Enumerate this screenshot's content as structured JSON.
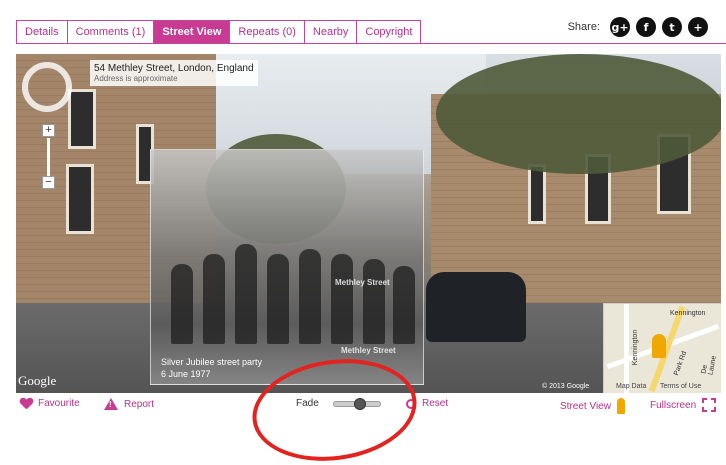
{
  "tabs": [
    {
      "label": "Details",
      "active": false
    },
    {
      "label": "Comments (1)",
      "active": false
    },
    {
      "label": "Street View",
      "active": true
    },
    {
      "label": "Repeats (0)",
      "active": false
    },
    {
      "label": "Nearby",
      "active": false
    },
    {
      "label": "Copyright",
      "active": false
    }
  ],
  "share": {
    "label": "Share:",
    "icons": [
      "google-plus-icon",
      "facebook-icon",
      "twitter-icon",
      "add-icon"
    ]
  },
  "streetview": {
    "address": "54 Methley Street, London, England",
    "address_note": "Address is approximate",
    "road_label": "Methley Street",
    "google_logo": "Google",
    "copyright": "© 2013 Google",
    "map_data": "Map Data",
    "terms": "Terms of Use",
    "map_labels": {
      "kennington": "Kennington",
      "road1": "Kennington",
      "road2": "Park Rd",
      "road3": "De Laune"
    }
  },
  "photo": {
    "caption_title": "Silver Jubilee street party",
    "caption_date": "6 June 1977"
  },
  "bottom_bar": {
    "favourite": "Favourite",
    "report": "Report",
    "fade": "Fade",
    "fade_value": 0.55,
    "reset": "Reset",
    "street_view": "Street View",
    "fullscreen": "Fullscreen"
  },
  "colors": {
    "accent": "#c93a93",
    "annotation": "#e3231f"
  }
}
